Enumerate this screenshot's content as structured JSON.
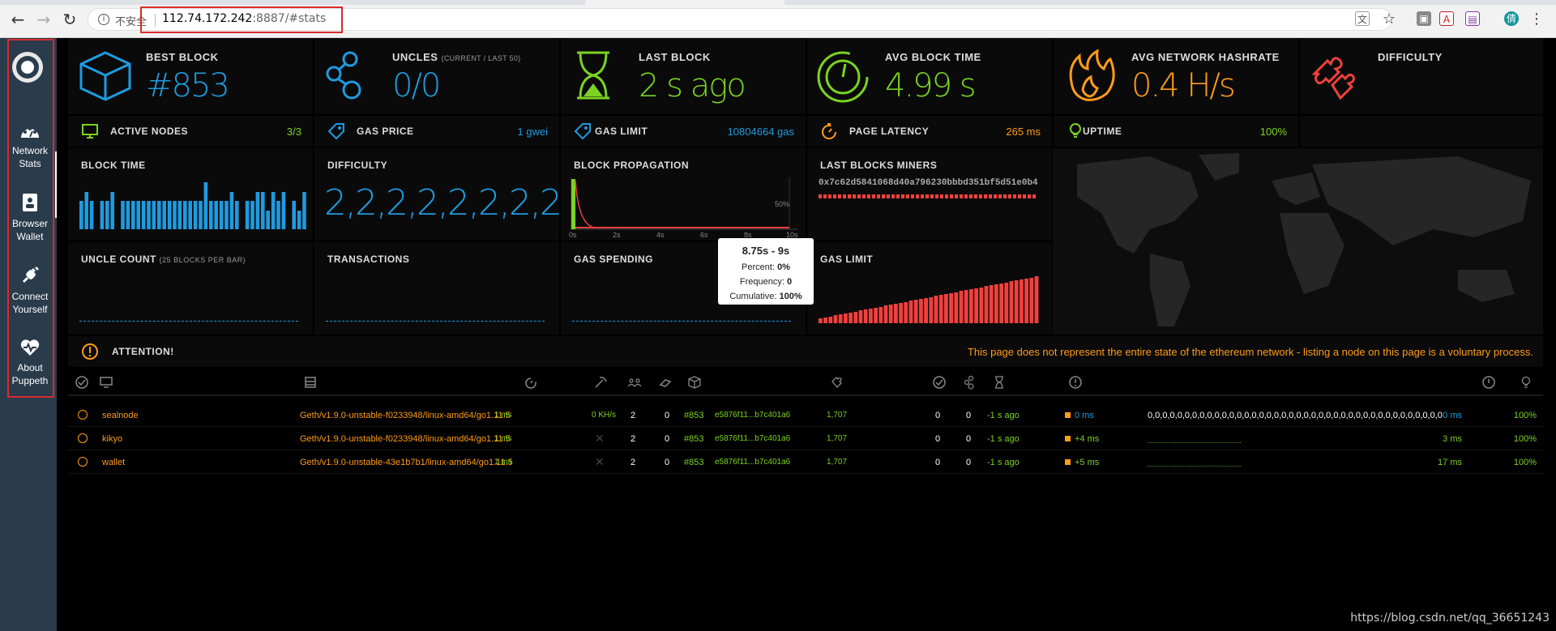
{
  "browser": {
    "insecure_label": "不安全",
    "url_host": "112.74.172.242",
    "url_rest": ":8887/#stats"
  },
  "sidebar": {
    "items": [
      {
        "label": "Network Stats"
      },
      {
        "label": "Browser Wallet"
      },
      {
        "label": "Connect Yourself"
      },
      {
        "label": "About Puppeth"
      }
    ]
  },
  "top": {
    "best_block": {
      "title": "BEST BLOCK",
      "value": "#853"
    },
    "uncles": {
      "title": "UNCLES",
      "sub": "(CURRENT / LAST 50)",
      "value": "0/0"
    },
    "last_block": {
      "title": "LAST BLOCK",
      "value": "2 s ago"
    },
    "avg_block_time": {
      "title": "AVG BLOCK TIME",
      "value": "4.99 s"
    },
    "avg_hashrate": {
      "title": "AVG NETWORK HASHRATE",
      "value": "0.4 H/s"
    },
    "difficulty": {
      "title": "DIFFICULTY",
      "value": ""
    }
  },
  "stats": {
    "active_nodes": {
      "title": "ACTIVE NODES",
      "value": "3/3"
    },
    "gas_price": {
      "title": "GAS PRICE",
      "value": "1 gwei"
    },
    "gas_limit": {
      "title": "GAS LIMIT",
      "value": "10804664 gas"
    },
    "page_latency": {
      "title": "PAGE LATENCY",
      "value": "265 ms"
    },
    "uptime": {
      "title": "UPTIME",
      "value": "100%"
    }
  },
  "panels": {
    "block_time": "BLOCK TIME",
    "difficulty": "DIFFICULTY",
    "difficulty_values": "2,2,2,2,2,2,2,2,2,2,2,2,2,2,2,2,2,2,2",
    "block_propagation": "BLOCK PROPAGATION",
    "prop_axis": [
      "0s",
      "2s",
      "4s",
      "6s",
      "8s",
      "10s"
    ],
    "prop_pct": "50%",
    "last_blocks_miners": "LAST BLOCKS MINERS",
    "miner_address": "0x7c62d5841068d40a796230bbbd351bf5d51e0b4",
    "uncle_count": "UNCLE COUNT",
    "uncle_count_sub": "(25 BLOCKS PER BAR)",
    "transactions": "TRANSACTIONS",
    "gas_spending": "GAS SPENDING",
    "gas_limit": "GAS LIMIT"
  },
  "tooltip": {
    "title": "8.75s - 9s",
    "percent_label": "Percent:",
    "percent": "0%",
    "freq_label": "Frequency:",
    "freq": "0",
    "cum_label": "Cumulative:",
    "cum": "100%"
  },
  "attention": {
    "title": "ATTENTION!",
    "message": "This page does not represent the entire state of the ethereum network - listing a node on this page is a voluntary process."
  },
  "nodes": [
    {
      "name": "sealnode",
      "client": "Geth/v1.9.0-unstable-f0233948/linux-amd64/go1.11.5",
      "latency": "1 ms",
      "hashrate": "0 KH/s",
      "peers": "2",
      "pending": "0",
      "block": "#853",
      "block_hash": "e5876f11...b7c401a6",
      "difficulty": "1,707",
      "txs": "0",
      "uncles": "0",
      "last_block": "-1 s ago",
      "propagation": "0 ms",
      "history": "0,0,0,0,0,0,0,0,0,0,0,0,0,0,0,0,0,0,0,0,0,0,0,0,0,0,0,0,0,0,0,0,0,0,0,0,0,0,0,0",
      "avg_prop": "0 ms",
      "uptime": "100%"
    },
    {
      "name": "kikyo",
      "client": "Geth/v1.9.0-unstable-f0233948/linux-amd64/go1.11.5",
      "latency": "1 ms",
      "hashrate": "",
      "peers": "2",
      "pending": "0",
      "block": "#853",
      "block_hash": "e5876f11...b7c401a6",
      "difficulty": "1,707",
      "txs": "0",
      "uncles": "0",
      "last_block": "-1 s ago",
      "propagation": "+4 ms",
      "history": "",
      "avg_prop": "3 ms",
      "uptime": "100%"
    },
    {
      "name": "wallet",
      "client": "Geth/v1.9.0-unstable-43e1b7b1/linux-amd64/go1.11.5",
      "latency": "1 ms",
      "hashrate": "",
      "peers": "2",
      "pending": "0",
      "block": "#853",
      "block_hash": "e5876f11...b7c401a6",
      "difficulty": "1,707",
      "txs": "0",
      "uncles": "0",
      "last_block": "-1 s ago",
      "propagation": "+5 ms",
      "history": "",
      "avg_prop": "17 ms",
      "uptime": "100%"
    }
  ],
  "watermark": "https://blog.csdn.net/qq_36651243",
  "colors": {
    "blue": "#1e9be0",
    "green": "#7bd321",
    "orange": "#ff9c1a",
    "red": "#f2403d",
    "sidebar": "#2a3b4c"
  }
}
